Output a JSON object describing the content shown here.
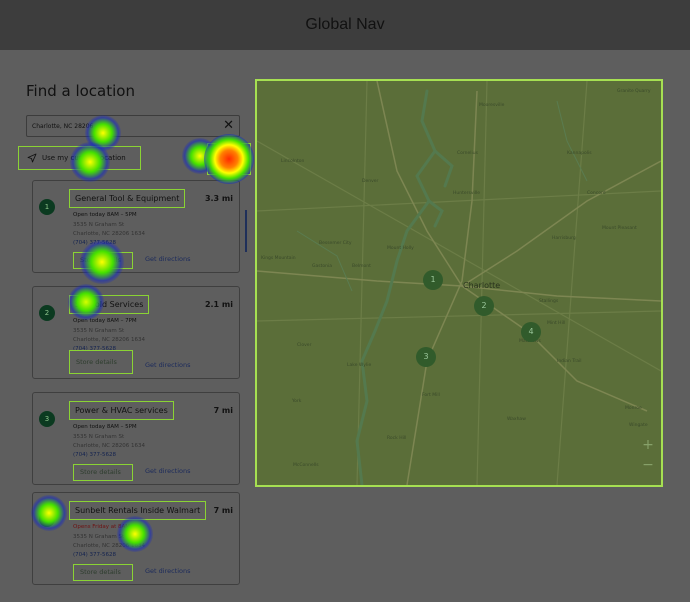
{
  "header": {
    "title": "Global Nav"
  },
  "page": {
    "heading": "Find a location"
  },
  "search": {
    "value": "Charlotte, NC 28206",
    "clear_symbol": "✕"
  },
  "use_location": {
    "label": "Use my current location"
  },
  "stores": [
    {
      "num": "1",
      "name": "General Tool & Equipment",
      "distance": "3.3 mi",
      "hours": "Open today 8AM – 5PM",
      "hours_status": "open",
      "address1": "3535 N Graham St",
      "address2": "Charlotte, NC  28206 1634",
      "phone": "(704) 377-5628",
      "details_label": "Store details",
      "directions_label": "Get directions"
    },
    {
      "num": "2",
      "name": "Scaffold Services",
      "distance": "2.1 mi",
      "hours": "Open today 8AM – 7PM",
      "hours_status": "open",
      "address1": "3535 N Graham St",
      "address2": "Charlotte, NC  28206 1634",
      "phone": "(704) 377-5628",
      "details_label": "Store details",
      "directions_label": "Get directions"
    },
    {
      "num": "3",
      "name": "Power & HVAC services",
      "distance": "7 mi",
      "hours": "Open today 8AM – 5PM",
      "hours_status": "open",
      "address1": "3535 N Graham St",
      "address2": "Charlotte, NC  28206 1634",
      "phone": "(704) 377-5628",
      "details_label": "Store details",
      "directions_label": "Get directions"
    },
    {
      "num": "4",
      "name": "Sunbelt Rentals Inside Walmart",
      "distance": "7 mi",
      "hours": "Opens Friday at 8AM",
      "hours_status": "closed",
      "address1": "3535 N Graham St",
      "address2": "Charlotte, NC  28206 1634",
      "phone": "(704) 377-5628",
      "details_label": "Store details",
      "directions_label": "Get directions"
    }
  ],
  "map": {
    "city_label": "Charlotte",
    "towns": [
      "Mooresville",
      "Kannapolis",
      "Concord",
      "Lincolnton",
      "Denver",
      "Huntersville",
      "Cornelius",
      "Gastonia",
      "Mount Holly",
      "Belmont",
      "Matthews",
      "Mint Hill",
      "Clover",
      "Fort Mill",
      "Rock Hill",
      "Indian Trail",
      "Waxhaw",
      "Monroe",
      "Harrisburg",
      "Kings Mountain",
      "Bessemer City",
      "Lake Wylie",
      "York",
      "McConnells",
      "Stallings",
      "Wingate",
      "Mount Pleasant",
      "Granite Quarry"
    ],
    "pins": [
      "1",
      "2",
      "3",
      "4"
    ],
    "zoom_in": "+",
    "zoom_out": "−"
  }
}
